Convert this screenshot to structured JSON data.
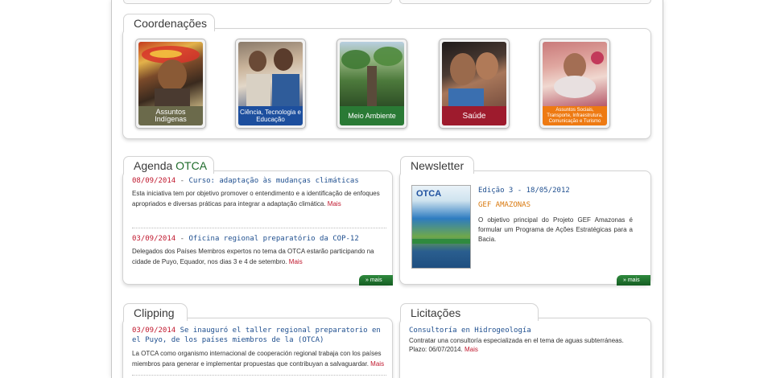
{
  "coordenacoes": {
    "title": "Coordenações",
    "items": [
      {
        "label": "Assuntos Indígenas",
        "color": "#6b6a4b",
        "icon": "indigenous-person-photo"
      },
      {
        "label": "Ciência, Tecnologia e Educação",
        "color": "#1d4f9e",
        "icon": "science-education-photo"
      },
      {
        "label": "Meio Ambiente",
        "color": "#2a7a35",
        "icon": "forest-tree-photo"
      },
      {
        "label": "Saúde",
        "color": "#9e1b2d",
        "icon": "health-mother-child-photo"
      },
      {
        "label": "Assuntos Sociais, Transporte, Infraestrutura, Comunicação e Turismo",
        "color": "#ee7a12",
        "icon": "social-affairs-photo"
      }
    ]
  },
  "agenda": {
    "title_prefix": "Agenda ",
    "title_accent": "OTCA",
    "items": [
      {
        "date": "08/09/2014",
        "separator": " - ",
        "headline": "Curso: adaptação às mudanças climáticas",
        "body": "Esta iniciativa tem por objetivo promover o entendimento e a identificação de enfoques apropriados e diversas práticas para integrar a adaptação climática. ",
        "more": "Mais"
      },
      {
        "date": "03/09/2014",
        "separator": " - ",
        "headline": "Oficina regional preparatório da COP-12",
        "body": "Delegados dos Países Membros expertos no tema da OTCA estarão participando na cidade de Puyo, Equador, nos dias 3 e 4 de setembro. ",
        "more": "Mais"
      }
    ],
    "more_button": "» mais"
  },
  "newsletter": {
    "title": "Newsletter",
    "edition": "Edição 3 - 18/05/2012",
    "subtitle": "GEF AMAZONAS",
    "body": "O objetivo principal do Projeto GEF Amazonas é formular um Programa de Ações Estratégicas para a Bacia.",
    "cover_brand": "OTCA",
    "more_button": "» mais"
  },
  "clipping": {
    "title": "Clipping",
    "items": [
      {
        "date": "03/09/2014",
        "headline": " Se inauguró el taller regional preparatorio en el Puyo, de los países miembros de la (OTCA)",
        "body": "La OTCA como organismo internacional de cooperación regional trabaja con los países miembros para generar e implementar propuestas que contribuyan a salvaguardar. ",
        "more": "Mais"
      }
    ]
  },
  "licitacoes": {
    "title": "Licitações",
    "items": [
      {
        "headline": "Consultoría en Hidrogeología",
        "body": "Contratar una consultoría especializada en el tema de aguas subterráneas. Plazo: 06/07/2014. ",
        "more": "Mais"
      }
    ]
  }
}
